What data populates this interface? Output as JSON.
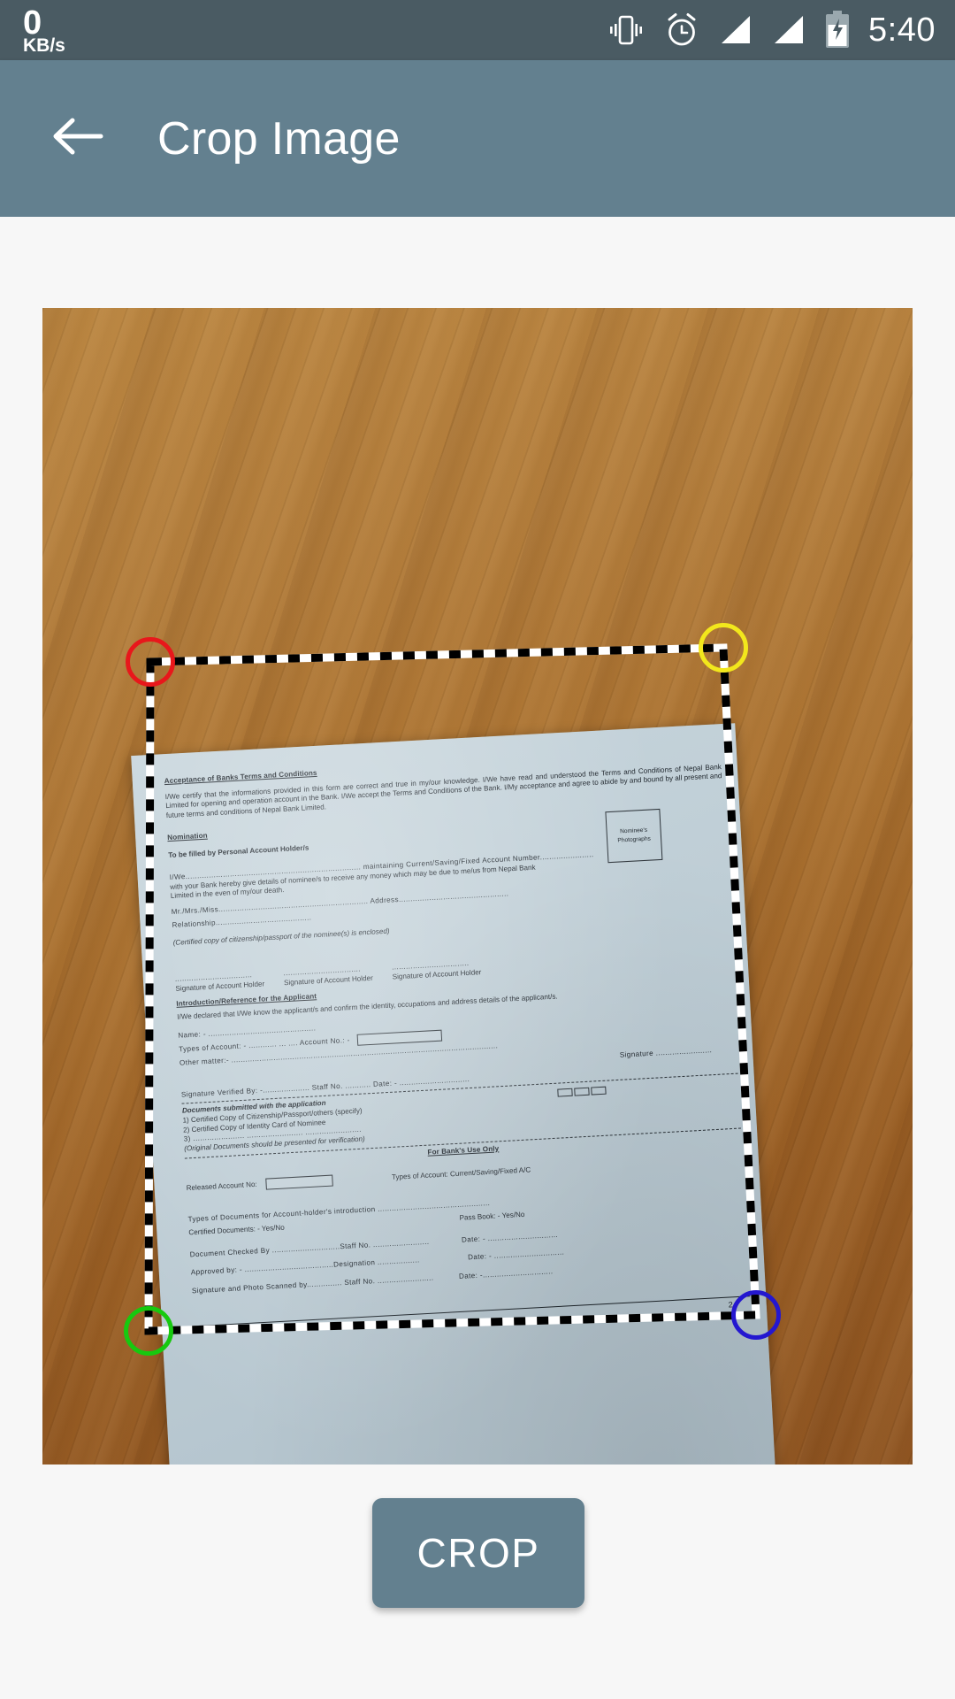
{
  "status_bar": {
    "network_speed_value": "0",
    "network_speed_unit": "KB/s",
    "icons": [
      "vibrate-icon",
      "alarm-icon",
      "signal-1-icon",
      "signal-2-icon",
      "battery-icon"
    ],
    "clock": "5:40",
    "background_color": "#4a5b63"
  },
  "action_bar": {
    "back_icon": "back-arrow-icon",
    "title": "Crop Image",
    "background_color": "#63808f"
  },
  "crop_view": {
    "handles": [
      {
        "name": "top-left",
        "color": "#e8171b"
      },
      {
        "name": "top-right",
        "color": "#f2e71c"
      },
      {
        "name": "bottom-left",
        "color": "#17c90f"
      },
      {
        "name": "bottom-right",
        "color": "#2417d0"
      }
    ],
    "border_style": "dashed black and white marching ants",
    "background": "wooden table"
  },
  "document": {
    "section_acceptance_title": "Acceptance of Banks Terms and Conditions",
    "acceptance_body": "I/We certify that the informations provided in this form are correct and true in my/our knowledge. I/We have read and understood the Terms and Conditions of Nepal Bank Limited for opening and operation account in the Bank. I/We accept the Terms and Conditions of the Bank. I/My acceptance and agree to abide by and bound by all present and future terms and conditions of Nepal Bank Limited.",
    "section_nomination_title": "Nomination",
    "to_be_filled": "To be filled by Personal Account Holder/s",
    "photo_box_line1": "Nominee's",
    "photo_box_line2": "Photographs",
    "nominee_line1": "I/We........................................................................... maintaining Current/Saving/Fixed  Account  Number.......................",
    "nominee_line2": "with your Bank hereby give details of nominee/s to receive any money which may be due to me/us from Nepal Bank",
    "nominee_line3": "Limited in the even of my/our death.",
    "mr_mrs_miss": "Mr./Mrs./Miss................................................................ Address...............................................",
    "relationship": "Relationship.........................................",
    "certified_copy_note": "(Certified copy of citizenship/passport of the nominee(s) is enclosed)",
    "signature_labels": [
      "Signature of Account Holder",
      "Signature of Account Holder",
      "Signature of Account Holder"
    ],
    "section_introduction_title": "Introduction/Reference for the Applicant",
    "introduction_body": "I/We declared that I/We know the applicant/s and confirm the identity, occupations and address details of the applicant/s.",
    "name_line": "Name: - ..............................................",
    "types_of_account_line": "Types of Account: -  ............  ...  .... Account No.: -",
    "other_matter_line": "Other matter:- ..................................................................................................................",
    "signature_right_label": "Signature  ........................",
    "signature_verified_line": "Signature Verified By: -.................... Staff No.     ...........    Date: - ..............................",
    "documents_submitted_title": "Documents submitted with the application",
    "documents_list": [
      "1) Certified Copy of Citizenship/Passport/others (specify)",
      "2) Certified Copy of Identity Card of Nominee",
      "3) ...................... ........................ ........................"
    ],
    "original_docs_note": "(Original Documents should be presented for verification)",
    "bank_use_only_title": "For Bank's Use Only",
    "released_account_label": "Released Account No:",
    "types_of_account_bank": "Types of Account: Current/Saving/Fixed A/C",
    "types_of_documents_line": "Types of Documents for Account-holder's introduction ................................................",
    "certified_documents_line": "Certified Documents: - Yes/No",
    "pass_book_line": "Pass Book: - Yes/No",
    "document_checked_line": "Document Checked By  .............................Staff No. ........................",
    "document_checked_date": "Date: - ..............................",
    "approved_by_line": "Approved by: - ......................................Designation ..................",
    "approved_by_date": "Date: - ..............................",
    "signature_scanned_line": "Signature and Photo Scanned by............... Staff No.      ........................",
    "signature_scanned_date": "Date: -..............................",
    "page_number": "2"
  },
  "footer": {
    "crop_button_label": "CROP",
    "crop_button_color": "#63808f"
  }
}
